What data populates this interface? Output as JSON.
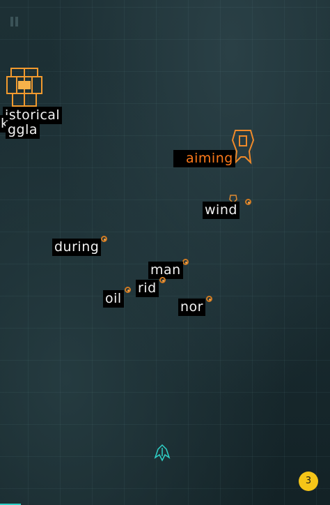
{
  "hud": {
    "bomb_count": "3",
    "pause_icon": "pause-icon"
  },
  "enemies": {
    "boss_left_word_1": "istorical",
    "boss_left_word_2": "k",
    "boss_left_word_3": "ggla",
    "aiming": {
      "typed": "",
      "rest": "aiming"
    },
    "wind": "wind",
    "during": "during",
    "man": "man",
    "rid": "rid",
    "oil": "oil",
    "nor": "nor"
  },
  "colors": {
    "typed": "#ff7a1a",
    "enemy": "#d27b22",
    "player": "#2fd2c8",
    "bomb": "#f5c518"
  }
}
